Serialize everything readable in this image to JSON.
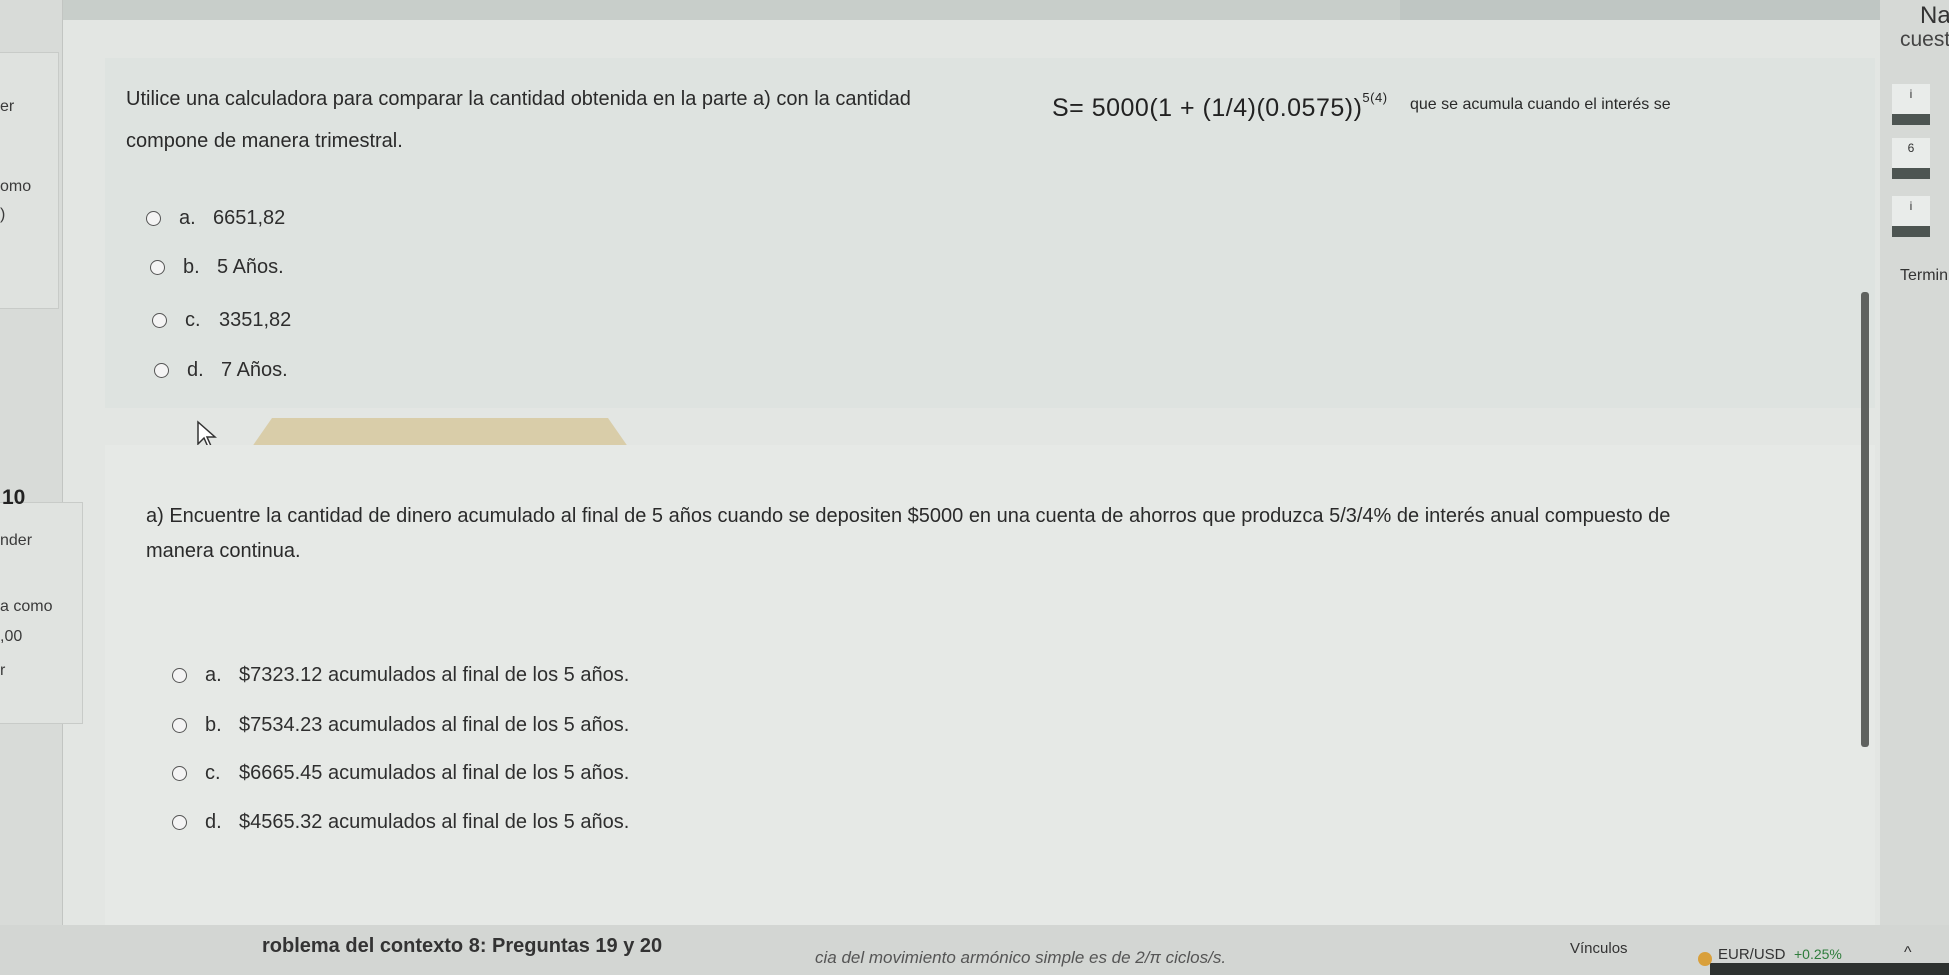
{
  "nav": {
    "title": "Na",
    "subtitle": "cuest",
    "buttons": [
      "i",
      "6",
      "i"
    ],
    "finish_label": "Termin"
  },
  "left_margin": {
    "q9_fragments": [
      "er",
      "omo",
      ")"
    ],
    "q10_number": "10",
    "q10_fragments": [
      "nder",
      "a como",
      ",00",
      "r"
    ]
  },
  "question_9": {
    "line1": "Utilice una calculadora para comparar la cantidad obtenida en la parte a) con la cantidad",
    "formula": "S= 5000(1 + (1/4)(0.0575))",
    "formula_exponent": "5(4)",
    "line1_tail": "que se acumula cuando el interés se",
    "line2": "compone de manera trimestral.",
    "options": [
      {
        "letter": "a.",
        "text": "6651,82"
      },
      {
        "letter": "b.",
        "text": "5 Años."
      },
      {
        "letter": "c.",
        "text": "3351,82"
      },
      {
        "letter": "d.",
        "text": "7 Años."
      }
    ]
  },
  "question_10": {
    "line1": "a) Encuentre la cantidad de dinero acumulado al final de 5 años cuando se depositen $5000 en una cuenta de ahorros que produzca 5/3/4% de interés anual compuesto de",
    "line2": "manera continua.",
    "options": [
      {
        "letter": "a.",
        "text": "$7323.12 acumulados al final de los 5 años."
      },
      {
        "letter": "b.",
        "text": "$7534.23 acumulados al final de los 5 años."
      },
      {
        "letter": "c.",
        "text": "$6665.45 acumulados al final de los 5 años."
      },
      {
        "letter": "d.",
        "text": "$4565.32 acumulados al final de los 5 años."
      }
    ]
  },
  "footer": {
    "problem_context": "roblema del contexto 8: Preguntas 19 y 20",
    "next_hint": "cia del movimiento armónico simple es de 2/π ciclos/s.",
    "links_label": "Vínculos",
    "ticker": "EUR/USD",
    "ticker_change": "+0.25%",
    "chevron": "^"
  }
}
